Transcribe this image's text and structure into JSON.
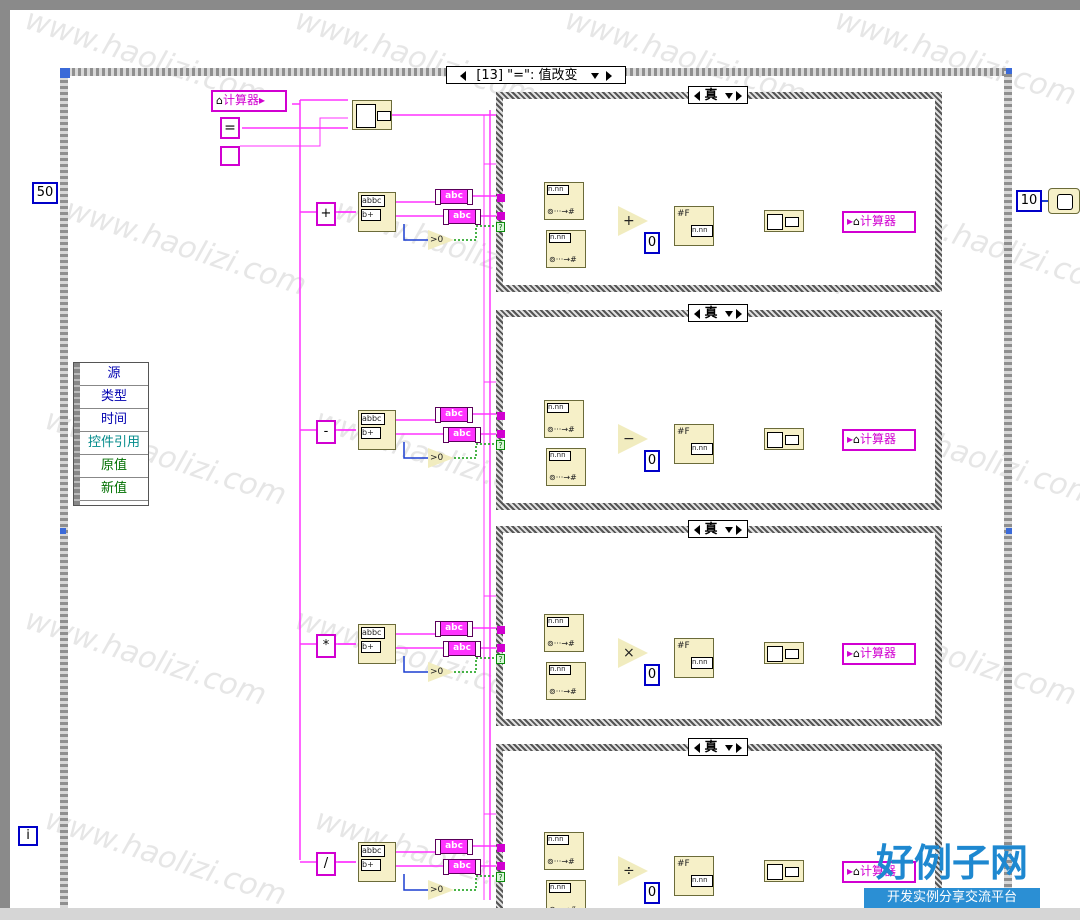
{
  "event_case": {
    "selector_label": "[13] \"=\": 值改变"
  },
  "event_node_rows": [
    {
      "label": "源",
      "color": "#0000b0"
    },
    {
      "label": "类型",
      "color": "#0000b0"
    },
    {
      "label": "时间",
      "color": "#0000b0"
    },
    {
      "label": "控件引用",
      "color": "#008a8a"
    },
    {
      "label": "原值",
      "color": "#007000"
    },
    {
      "label": "新值",
      "color": "#007000"
    }
  ],
  "loop": {
    "wait_constant": "50",
    "iteration_terminal": "i",
    "outer_constant": "10"
  },
  "calculator_ref": "计算器",
  "equals_constant": "=",
  "abc_label": "abc",
  "cases": [
    {
      "selector": "真",
      "op_constant": "+",
      "operator_symbol": "+",
      "zero_constant": "0",
      "has_output": true
    },
    {
      "selector": "真",
      "op_constant": "-",
      "operator_symbol": "−",
      "zero_constant": "0",
      "has_output": true
    },
    {
      "selector": "真",
      "op_constant": "*",
      "operator_symbol": "×",
      "zero_constant": "0",
      "has_output": true
    },
    {
      "selector": "真",
      "op_constant": "/",
      "operator_symbol": "÷",
      "zero_constant": "0",
      "has_output": true
    }
  ],
  "watermark": "www.haolizi.com",
  "logo": {
    "main": "好例子网",
    "sub": "开发实例分享交流平台"
  },
  "colors": {
    "string_wire": "#ff33ff",
    "numeric_wire": "#ff8c1a",
    "int_wire": "#1b3fd1",
    "bool_wire": "#0b9b0b"
  }
}
